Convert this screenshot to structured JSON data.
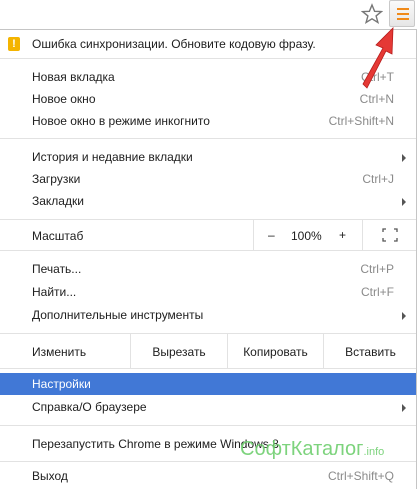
{
  "warning": {
    "text": "Ошибка синхронизации. Обновите кодовую фразу."
  },
  "group1": [
    {
      "label": "Новая вкладка",
      "shortcut": "Ctrl+T"
    },
    {
      "label": "Новое окно",
      "shortcut": "Ctrl+N"
    },
    {
      "label": "Новое окно в режиме инкогнито",
      "shortcut": "Ctrl+Shift+N"
    }
  ],
  "group2": [
    {
      "label": "История и недавние вкладки",
      "shortcut": ""
    },
    {
      "label": "Загрузки",
      "shortcut": "Ctrl+J"
    },
    {
      "label": "Закладки",
      "shortcut": ""
    }
  ],
  "zoom": {
    "label": "Масштаб",
    "minus": "–",
    "value": "100%",
    "plus": "+"
  },
  "group3": [
    {
      "label": "Печать...",
      "shortcut": "Ctrl+P"
    },
    {
      "label": "Найти...",
      "shortcut": "Ctrl+F"
    },
    {
      "label": "Дополнительные инструменты",
      "shortcut": ""
    }
  ],
  "edit": {
    "label": "Изменить",
    "cut": "Вырезать",
    "copy": "Копировать",
    "paste": "Вставить"
  },
  "group4": [
    {
      "label": "Настройки"
    },
    {
      "label": "Справка/О браузере"
    }
  ],
  "relaunch": {
    "label": "Перезапустить Chrome в режиме Windows 8"
  },
  "exit": {
    "label": "Выход",
    "shortcut": "Ctrl+Shift+Q"
  },
  "watermark": {
    "main": "СофтКаталог",
    "suffix": ".info"
  },
  "colors": {
    "highlight": "#4178d6",
    "menu_icon": "#f08a1a",
    "warning": "#f4b400",
    "arrow": "#e53935"
  },
  "icons": [
    "star-icon",
    "hamburger-menu-icon",
    "warning-icon",
    "submenu-arrow-icon",
    "fullscreen-icon",
    "red-arrow-icon"
  ]
}
